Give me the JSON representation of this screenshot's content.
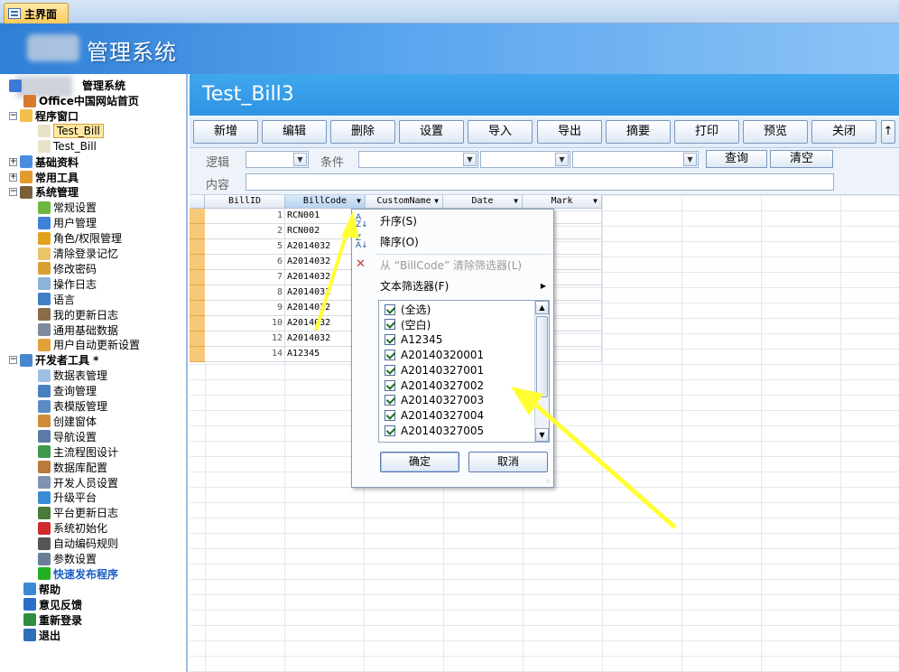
{
  "tab": {
    "label": "主界面"
  },
  "banner": {
    "title": "管理系统"
  },
  "sidebar": {
    "root_label": "管理系统",
    "items": [
      {
        "label": "Office中国网站首页",
        "bold": true
      },
      {
        "label": "程序窗口",
        "bold": true
      },
      {
        "label": "Test_Bill",
        "selected": true
      },
      {
        "label": "Test_Bill"
      },
      {
        "label": "基础资料",
        "bold": true
      },
      {
        "label": "常用工具",
        "bold": true
      },
      {
        "label": "系统管理",
        "bold": true
      },
      {
        "label": "常规设置"
      },
      {
        "label": "用户管理"
      },
      {
        "label": "角色/权限管理"
      },
      {
        "label": "清除登录记忆"
      },
      {
        "label": "修改密码"
      },
      {
        "label": "操作日志"
      },
      {
        "label": "语言"
      },
      {
        "label": "我的更新日志"
      },
      {
        "label": "通用基础数据"
      },
      {
        "label": "用户自动更新设置"
      },
      {
        "label": "开发者工具 *",
        "bold": true
      },
      {
        "label": "数据表管理"
      },
      {
        "label": "查询管理"
      },
      {
        "label": "表模版管理"
      },
      {
        "label": "创建窗体"
      },
      {
        "label": "导航设置"
      },
      {
        "label": "主流程图设计"
      },
      {
        "label": "数据库配置"
      },
      {
        "label": "开发人员设置"
      },
      {
        "label": "升级平台"
      },
      {
        "label": "平台更新日志"
      },
      {
        "label": "系统初始化"
      },
      {
        "label": "自动编码规则"
      },
      {
        "label": "参数设置"
      },
      {
        "label": "快速发布程序",
        "bold": true
      },
      {
        "label": "帮助",
        "bold": true
      },
      {
        "label": "意见反馈",
        "bold": true
      },
      {
        "label": "重新登录",
        "bold": true
      },
      {
        "label": "退出",
        "bold": true
      }
    ]
  },
  "content": {
    "title": "Test_Bill3",
    "toolbar": [
      "新增",
      "编辑",
      "删除",
      "设置",
      "导入",
      "导出",
      "摘要",
      "打印",
      "预览",
      "关闭",
      "↑"
    ],
    "filter": {
      "logic_label": "逻辑",
      "condition_label": "条件",
      "content_label": "内容",
      "query_button": "查询",
      "clear_button": "清空"
    }
  },
  "grid": {
    "headers": [
      "BillID",
      "BillCode",
      "CustomName",
      "Date",
      "Mark"
    ],
    "rows": [
      {
        "id": "1",
        "code": "RCN001"
      },
      {
        "id": "2",
        "code": "RCN002"
      },
      {
        "id": "5",
        "code": "A2014032"
      },
      {
        "id": "6",
        "code": "A2014032"
      },
      {
        "id": "7",
        "code": "A2014032"
      },
      {
        "id": "8",
        "code": "A2014032"
      },
      {
        "id": "9",
        "code": "A2014032"
      },
      {
        "id": "10",
        "code": "A2014032"
      },
      {
        "id": "12",
        "code": "A2014032"
      },
      {
        "id": "14",
        "code": "A12345"
      }
    ]
  },
  "menu": {
    "sort_asc": "升序(S)",
    "sort_desc": "降序(O)",
    "clear_filter": "从 “BillCode” 清除筛选器(L)",
    "text_filter": "文本筛选器(F)",
    "list": [
      "(全选)",
      "(空白)",
      "A12345",
      "A20140320001",
      "A20140327001",
      "A20140327002",
      "A20140327003",
      "A20140327004",
      "A20140327005"
    ],
    "ok": "确定",
    "cancel": "取消"
  },
  "colors": {
    "accent": "#2f93e2",
    "arrow": "#ffff33",
    "selection": "#f8c879"
  }
}
